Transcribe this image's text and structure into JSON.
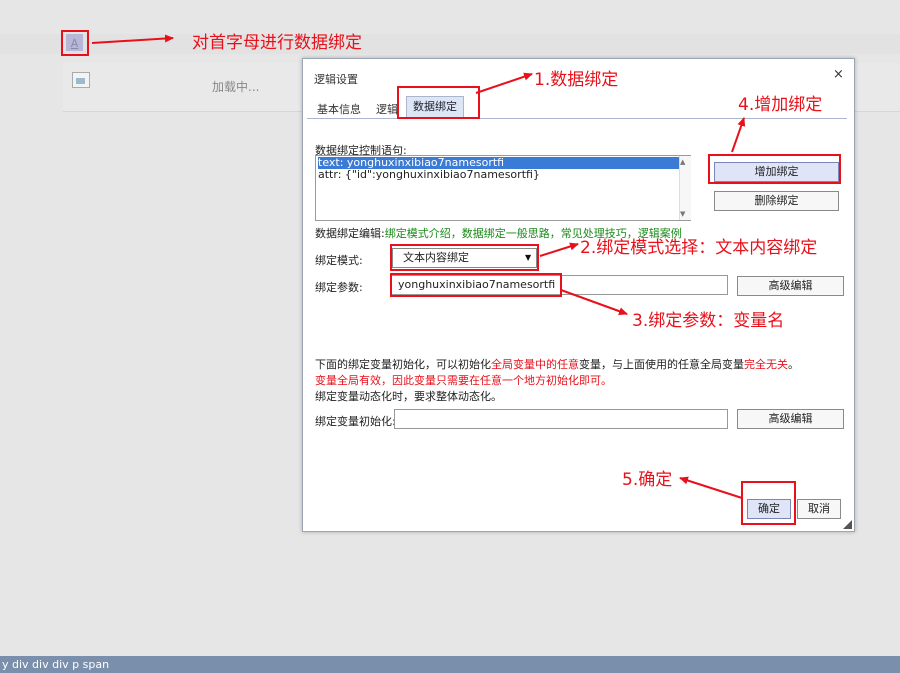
{
  "background": {
    "letter": "A",
    "loading_text": "加载中..."
  },
  "annotations": {
    "first_letter": "对首字母进行数据绑定",
    "step1": "1.数据绑定",
    "step2": "2.绑定模式选择：文本内容绑定",
    "step3": "3.绑定参数：变量名",
    "step4": "4.增加绑定",
    "step5": "5.确定"
  },
  "dialog": {
    "title": "逻辑设置",
    "close": "×",
    "tabs": [
      "基本信息",
      "逻辑",
      "数据绑定"
    ],
    "control_label": "数据绑定控制语句:",
    "statements": [
      "text: yonghuxinxibiao7namesortfi",
      "attr: {\"id\":yonghuxinxibiao7namesortfi}"
    ],
    "add_binding": "增加绑定",
    "delete_binding": "删除绑定",
    "edit_prefix": "数据绑定编辑:",
    "edit_links": "绑定模式介绍，数据绑定一般思路，常见处理技巧，逻辑案例",
    "mode_label": "绑定模式:",
    "mode_value": "文本内容绑定",
    "param_label": "绑定参数:",
    "param_value": "yonghuxinxibiao7namesortfi",
    "advanced_edit": "高级编辑",
    "note1_a": "下面的绑定变量初始化，可以初始化",
    "note1_b": "全局变量中的任意",
    "note1_c": "变量，与上面使用的任意全局变量",
    "note1_d": "完全无关",
    "note1_e": "。",
    "note2": "变量全局有效，因此变量只需要在任意一个地方初始化即可。",
    "note3": "绑定变量动态化时，要求整体动态化。",
    "init_label": "绑定变量初始化:",
    "init_value": "",
    "ok": "确定",
    "cancel": "取消"
  },
  "status_bar": "y   div   div   div   p   span",
  "colors": {
    "annotation_red": "#e8101a",
    "link_green": "#1a8a1a",
    "status_bar": "#7a8fac",
    "selection_blue": "#3b7bd6"
  }
}
